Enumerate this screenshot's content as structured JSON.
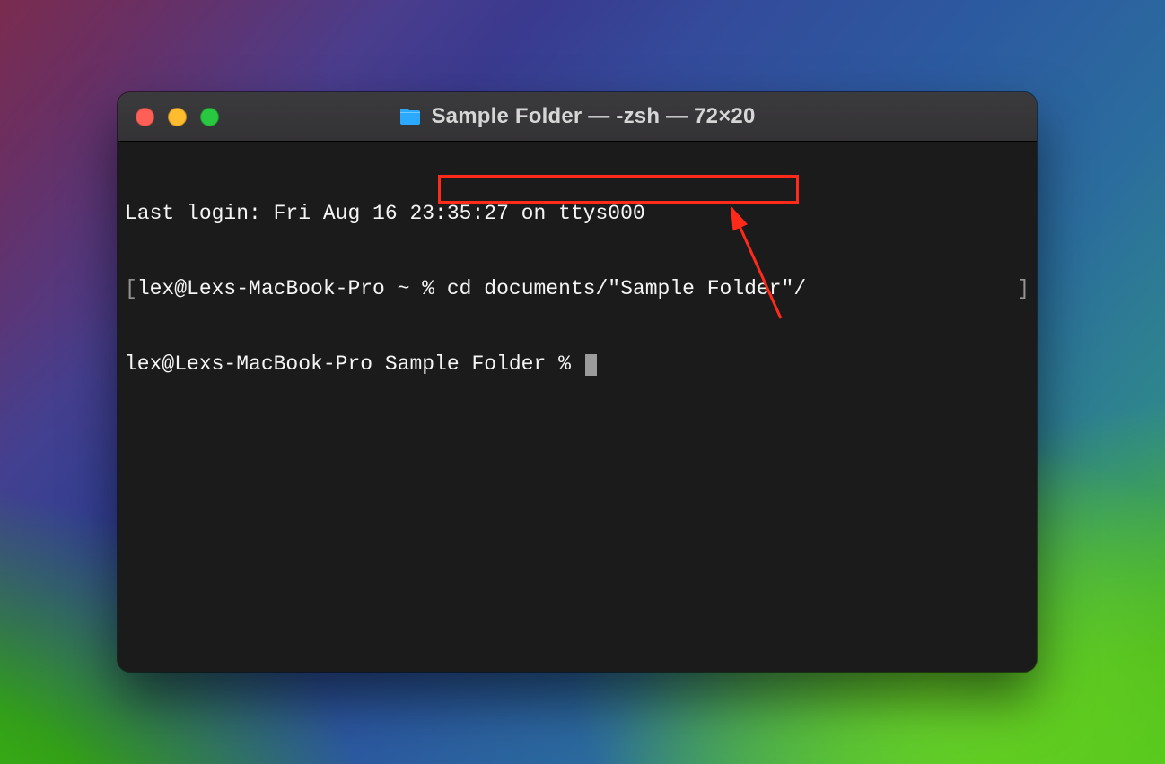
{
  "titlebar": {
    "title": "Sample Folder — -zsh — 72×20"
  },
  "terminal": {
    "last_login": "Last login: Fri Aug 16 23:35:27 on ttys000",
    "prompt1_prefix": "lex@Lexs-MacBook-Pro ~ % ",
    "prompt1_left_bracket": "[",
    "prompt1_right_bracket": "]",
    "command1": "cd documents/\"Sample Folder\"/",
    "prompt2": "lex@Lexs-MacBook-Pro Sample Folder % "
  },
  "annotation": {
    "color": "#ff2a1a"
  }
}
